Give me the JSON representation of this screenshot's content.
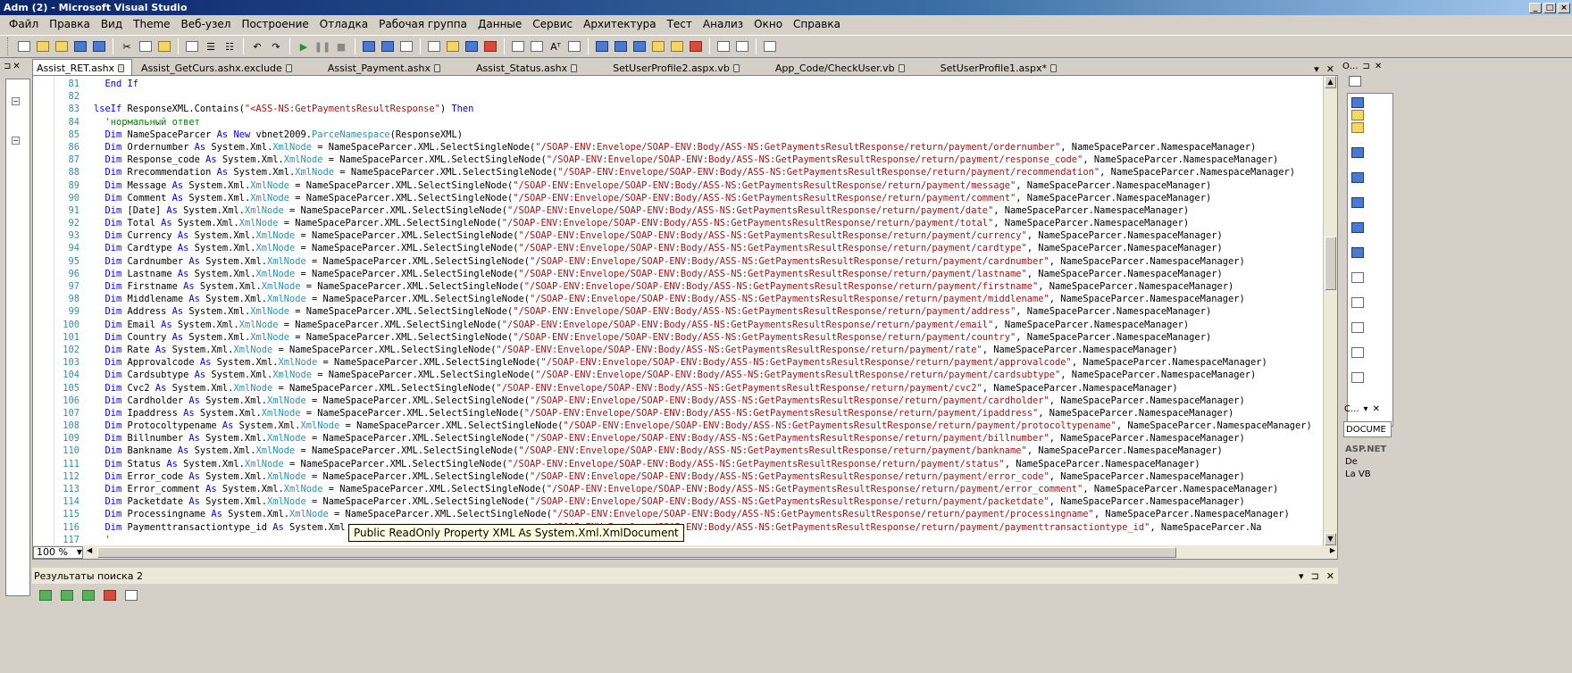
{
  "window": {
    "title": "Adm (2) - Microsoft Visual Studio"
  },
  "menu": [
    "Файл",
    "Правка",
    "Вид",
    "Theme",
    "Веб-узел",
    "Построение",
    "Отладка",
    "Рабочая группа",
    "Данные",
    "Сервис",
    "Архитектура",
    "Тест",
    "Анализ",
    "Окно",
    "Справка"
  ],
  "tabs": [
    {
      "label": "Assist_RET.ashx",
      "active": true
    },
    {
      "label": "Assist_GetCurs.ashx.exclude",
      "active": false
    },
    {
      "label": "Assist_Payment.ashx",
      "active": false
    },
    {
      "label": "Assist_Status.ashx",
      "active": false
    },
    {
      "label": "SetUserProfile2.aspx.vb",
      "active": false
    },
    {
      "label": "App_Code/CheckUser.vb",
      "active": false
    },
    {
      "label": "SetUserProfile1.aspx*",
      "active": false
    }
  ],
  "editor": {
    "zoom": "100 %",
    "code": [
      {
        "n": "81",
        "t": [
          [
            "  ",
            ""
          ],
          [
            "End If",
            "kw"
          ]
        ]
      },
      {
        "n": "82",
        "t": []
      },
      {
        "n": "83",
        "t": [
          [
            "lseIf",
            "kw"
          ],
          [
            " ResponseXML.Contains(",
            ""
          ],
          [
            "\"<ASS-NS:GetPaymentsResultResponse\"",
            "st"
          ],
          [
            ") ",
            ""
          ],
          [
            "Then",
            "kw"
          ]
        ]
      },
      {
        "n": "84",
        "t": [
          [
            "  'нормальный ответ",
            "cm"
          ]
        ]
      },
      {
        "n": "85",
        "t": [
          [
            "  ",
            ""
          ],
          [
            "Dim",
            "kw"
          ],
          [
            " NameSpaceParcer ",
            ""
          ],
          [
            "As",
            "kw"
          ],
          [
            " ",
            ""
          ],
          [
            "New",
            "kw"
          ],
          [
            " vbnet2009.",
            ""
          ],
          [
            "ParceNamespace",
            "ty"
          ],
          [
            "(ResponseXML)",
            ""
          ]
        ]
      },
      {
        "n": "86",
        "f": "Ordernumber",
        "p": "ordernumber"
      },
      {
        "n": "87",
        "f": "Response_code",
        "p": "response_code"
      },
      {
        "n": "88",
        "f": "Rrecommendation",
        "p": "recommendation"
      },
      {
        "n": "89",
        "f": "Message",
        "p": "message"
      },
      {
        "n": "90",
        "f": "Comment",
        "p": "comment"
      },
      {
        "n": "91",
        "f": "[Date]",
        "p": "date"
      },
      {
        "n": "92",
        "f": "Total",
        "p": "total"
      },
      {
        "n": "93",
        "f": "Currency",
        "p": "currency"
      },
      {
        "n": "94",
        "f": "Cardtype",
        "p": "cardtype"
      },
      {
        "n": "95",
        "f": "Cardnumber",
        "p": "cardnumber"
      },
      {
        "n": "96",
        "f": "Lastname",
        "p": "lastname"
      },
      {
        "n": "97",
        "f": "Firstname",
        "p": "firstname"
      },
      {
        "n": "98",
        "f": "Middlename",
        "p": "middlename"
      },
      {
        "n": "99",
        "f": "Address",
        "p": "address"
      },
      {
        "n": "100",
        "f": "Email",
        "p": "email"
      },
      {
        "n": "101",
        "f": "Country",
        "p": "country"
      },
      {
        "n": "102",
        "f": "Rate",
        "p": "rate"
      },
      {
        "n": "103",
        "f": "Approvalcode",
        "p": "approvalcode"
      },
      {
        "n": "104",
        "f": "Cardsubtype",
        "p": "cardsubtype"
      },
      {
        "n": "105",
        "f": "Cvc2",
        "p": "cvc2"
      },
      {
        "n": "106",
        "f": "Cardholder",
        "p": "cardholder"
      },
      {
        "n": "107",
        "f": "Ipaddress",
        "p": "ipaddress"
      },
      {
        "n": "108",
        "f": "Protocoltypename",
        "p": "protocoltypename"
      },
      {
        "n": "109",
        "f": "Billnumber",
        "p": "billnumber"
      },
      {
        "n": "110",
        "f": "Bankname",
        "p": "bankname"
      },
      {
        "n": "111",
        "f": "Status",
        "p": "status"
      },
      {
        "n": "112",
        "f": "Error_code",
        "p": "error_code"
      },
      {
        "n": "113",
        "f": "Error_comment",
        "p": "error_comment"
      },
      {
        "n": "114",
        "f": "Packetdate",
        "p": "packetdate"
      },
      {
        "n": "115",
        "f": "Processingname",
        "p": "processingname"
      },
      {
        "n": "116",
        "t": [
          [
            "  ",
            ""
          ],
          [
            "Dim",
            "kw"
          ],
          [
            " Paymenttransactiontype_id ",
            ""
          ],
          [
            "As",
            "kw"
          ],
          [
            " System.Xml",
            ""
          ],
          [
            "                                    ",
            ""
          ],
          [
            "\"/SOAP-ENV:Envelope/SOAP-ENV:Body/ASS-NS:GetPaymentsResultResponse/return/payment/paymenttransactiontype_id\"",
            "st"
          ],
          [
            ", NameSpaceParcer.Na",
            ""
          ]
        ]
      },
      {
        "n": "117",
        "t": [
          [
            "  '",
            "cm"
          ]
        ]
      }
    ],
    "xpath_prefix": "/SOAP-ENV:Envelope/SOAP-ENV:Body/ASS-NS:GetPaymentsResultResponse/return/payment/",
    "tooltip": "Public ReadOnly Property XML As System.Xml.XmlDocument"
  },
  "results": {
    "title": "Результаты поиска 2"
  },
  "right_panel": {
    "top_label": "О...",
    "mid_label": "С...",
    "dropdown_value": "DOCUME",
    "props": [
      {
        "label": "ASP.NET",
        "bold": true
      },
      {
        "label": "De",
        "bold": false
      },
      {
        "label": "La  VB",
        "bold": false
      }
    ]
  }
}
